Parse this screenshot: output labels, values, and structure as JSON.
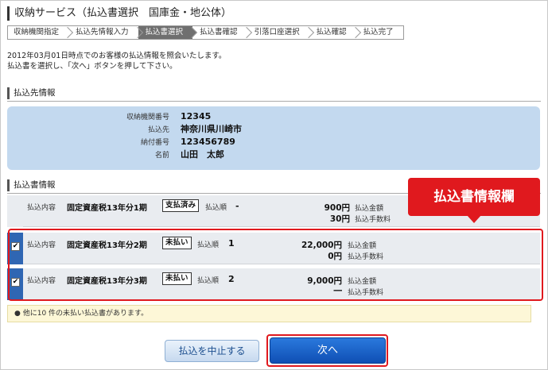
{
  "page": {
    "title": "収納サービス（払込書選択　国庫金・地公体）"
  },
  "steps": [
    {
      "label": "収納機関指定",
      "active": false
    },
    {
      "label": "払込先情報入力",
      "active": false
    },
    {
      "label": "払込書選択",
      "active": true
    },
    {
      "label": "払込書確認",
      "active": false
    },
    {
      "label": "引落口座選択",
      "active": false
    },
    {
      "label": "払込確認",
      "active": false
    },
    {
      "label": "払込完了",
      "active": false
    }
  ],
  "intro": {
    "line1": "2012年03月01日時点でのお客様の払込情報を照会いたします。",
    "line2": "払込書を選択し、「次へ」ボタンを押して下さい。"
  },
  "payee_section": {
    "heading": "払込先情報",
    "rows": [
      {
        "label": "収納機関番号",
        "value": "12345"
      },
      {
        "label": "払込先",
        "value": "神奈川県川崎市"
      },
      {
        "label": "納付番号",
        "value": "123456789"
      },
      {
        "label": "名前",
        "value": "山田　太郎"
      }
    ]
  },
  "bills_section": {
    "heading": "払込書情報",
    "callout": "払込書情報欄",
    "item_label": "払込内容",
    "order_label": "払込順",
    "amount_label": "払込金額",
    "fee_label": "払込手数料",
    "bills": [
      {
        "checked": false,
        "item": "固定資産税13年分1期",
        "status": "支払済み",
        "order": "-",
        "amount": "900円",
        "fee": "30円"
      },
      {
        "checked": true,
        "item": "固定資産税13年分2期",
        "status": "未払い",
        "order": "1",
        "amount": "22,000円",
        "fee": "0円"
      },
      {
        "checked": true,
        "item": "固定資産税13年分3期",
        "status": "未払い",
        "order": "2",
        "amount": "9,000円",
        "fee": "―"
      }
    ]
  },
  "notice": "●  他に10 件の未払い払込書があります。",
  "buttons": {
    "cancel": "払込を中止する",
    "next": "次へ"
  },
  "colors": {
    "accent_red": "#e0191e",
    "unpaid_bar": "#2f66b3",
    "payee_bg": "#c3d9ef"
  }
}
